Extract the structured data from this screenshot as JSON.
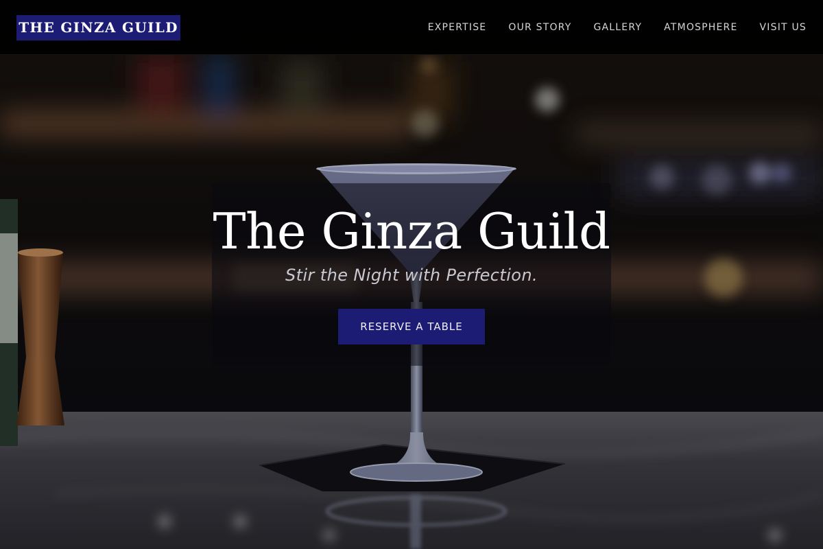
{
  "nav": {
    "brand": "THE GINZA GUILD",
    "links": [
      {
        "label": "EXPERTISE"
      },
      {
        "label": "OUR STORY"
      },
      {
        "label": "GALLERY"
      },
      {
        "label": "ATMOSPHERE"
      },
      {
        "label": "VISIT US"
      }
    ]
  },
  "hero": {
    "title": "The Ginza Guild",
    "tagline": "Stir the Night with Perfection.",
    "cta_label": "RESERVE A TABLE",
    "image_icon": "martini-glass-icon"
  },
  "colors": {
    "brand_navy": "#1c1c74",
    "nav_background": "#000000",
    "nav_text": "#d6d6d6",
    "title_text": "#ffffff"
  }
}
